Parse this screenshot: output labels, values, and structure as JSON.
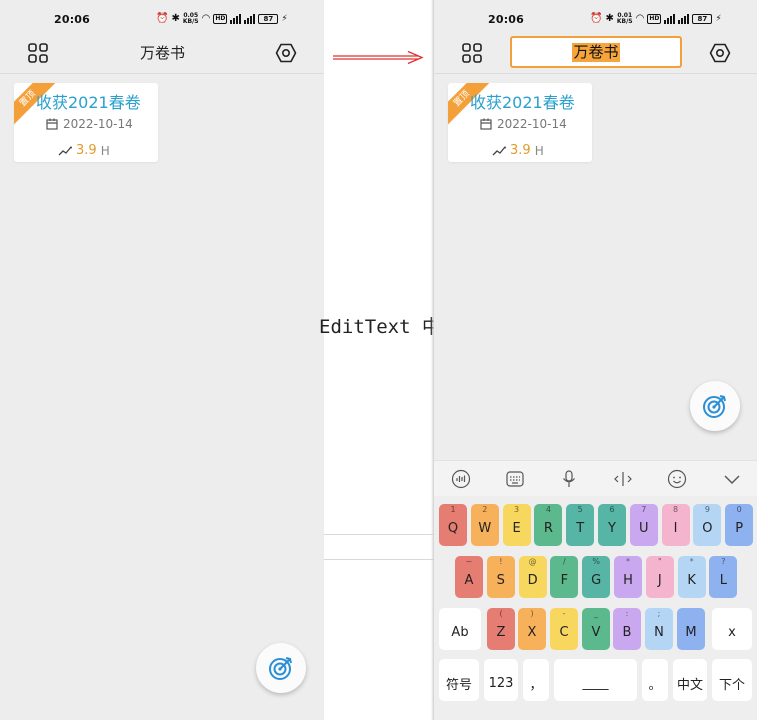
{
  "colors": {
    "accent_orange": "#f4a03a",
    "title_blue": "#2aa0cf",
    "arrow_red": "#e03030",
    "key_colors": [
      "#e67d72",
      "#f7b15a",
      "#f7d75e",
      "#5cb88d",
      "#56b5a5",
      "#caa8ef",
      "#f4b4cd",
      "#b4d6f4",
      "#8eb1ef"
    ]
  },
  "status_bar": {
    "time": "20:06",
    "speed_left": {
      "value": "0.05",
      "unit": "KB/S"
    },
    "speed_right": {
      "value": "0.01",
      "unit": "KB/S"
    },
    "hd": "HD",
    "battery": "87",
    "icons": [
      "alarm-icon",
      "bluetooth-icon",
      "wifi-icon",
      "signal-icon",
      "charging-icon"
    ]
  },
  "left_screen": {
    "toolbar": {
      "title": "万卷书",
      "left_icon": "grid-icon",
      "right_icon": "settings-icon"
    },
    "card": {
      "ribbon": "置顶",
      "title": "收获2021春卷",
      "date": "2022-10-14",
      "hours": "3.9",
      "hours_unit": "H"
    },
    "fab_icon": "target-icon"
  },
  "middle": {
    "caption": "EditText 中",
    "arrow_icon": "arrow-right-icon"
  },
  "right_screen": {
    "toolbar": {
      "title": "万卷书",
      "left_icon": "grid-icon",
      "right_icon": "settings-icon"
    },
    "card": {
      "ribbon": "置顶",
      "title": "收获2021春卷",
      "date": "2022-10-14",
      "hours": "3.9",
      "hours_unit": "H"
    },
    "fab_icon": "target-icon",
    "keyboard_toolbar": [
      "voice-wave-icon",
      "keyboard-icon",
      "microphone-icon",
      "cursor-icon",
      "emoji-icon",
      "collapse-icon"
    ],
    "keyboard": {
      "row1": [
        {
          "main": "Q",
          "hint": "1"
        },
        {
          "main": "W",
          "hint": "2"
        },
        {
          "main": "E",
          "hint": "3"
        },
        {
          "main": "R",
          "hint": "4"
        },
        {
          "main": "T",
          "hint": "5"
        },
        {
          "main": "Y",
          "hint": "6"
        },
        {
          "main": "U",
          "hint": "7"
        },
        {
          "main": "I",
          "hint": "8"
        },
        {
          "main": "O",
          "hint": "9"
        },
        {
          "main": "P",
          "hint": "0"
        }
      ],
      "row2": [
        {
          "main": "A",
          "hint": "~"
        },
        {
          "main": "S",
          "hint": "!"
        },
        {
          "main": "D",
          "hint": "@"
        },
        {
          "main": "F",
          "hint": "/"
        },
        {
          "main": "G",
          "hint": "%"
        },
        {
          "main": "H",
          "hint": "*"
        },
        {
          "main": "J",
          "hint": "\""
        },
        {
          "main": "K",
          "hint": "*"
        },
        {
          "main": "L",
          "hint": "?"
        }
      ],
      "row3": [
        {
          "main": "Ab",
          "hint": ""
        },
        {
          "main": "Z",
          "hint": "("
        },
        {
          "main": "X",
          "hint": ")"
        },
        {
          "main": "C",
          "hint": "-"
        },
        {
          "main": "V",
          "hint": "_"
        },
        {
          "main": "B",
          "hint": ":"
        },
        {
          "main": "N",
          "hint": ";"
        },
        {
          "main": "M",
          "hint": ""
        },
        {
          "main": "x",
          "hint": ""
        }
      ],
      "row4": [
        {
          "main": "符号",
          "hint": ""
        },
        {
          "main": "123",
          "hint": ""
        },
        {
          "main": "，",
          "hint": ""
        },
        {
          "main": "____",
          "hint": ""
        },
        {
          "main": "。",
          "hint": ""
        },
        {
          "main": "中文",
          "hint": ""
        },
        {
          "main": "下个",
          "hint": ""
        }
      ]
    }
  }
}
